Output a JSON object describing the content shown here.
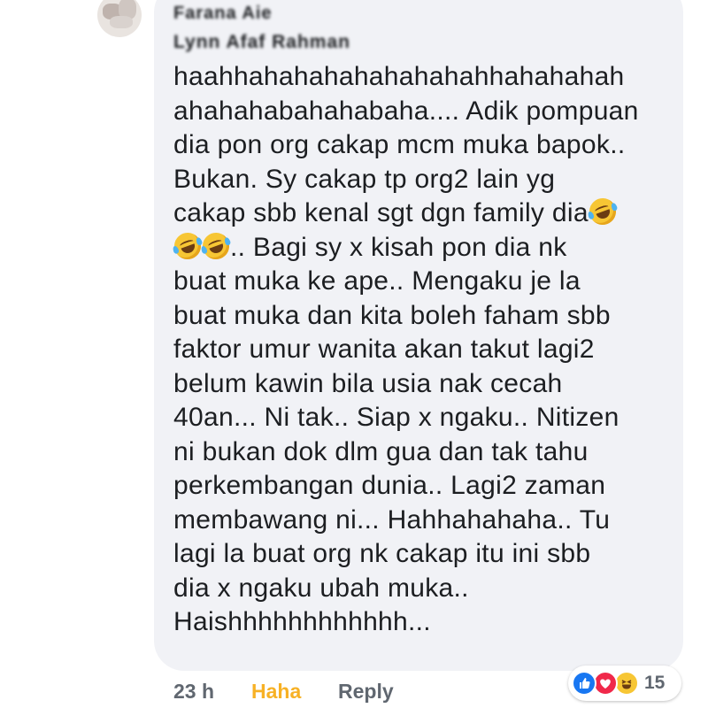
{
  "comment": {
    "commenter_name": "Farana Aie",
    "mention": "Lynn Afaf Rahman",
    "lines": [
      {
        "before": "haahhahahahahahahahahhahahahah",
        "emojis_after": 0
      },
      {
        "before": "ahahahabahahabaha.... Adik  pompuan",
        "emojis_after": 0
      },
      {
        "before": "dia pon org cakap mcm muka bapok..",
        "emojis_after": 0
      },
      {
        "before": "Bukan. Sy cakap tp org2 lain yg",
        "emojis_after": 0
      },
      {
        "before": "cakap sbb kenal sgt dgn family dia",
        "emojis_after": 1
      },
      {
        "emojis_before": 2,
        "before": ".. Bagi sy x kisah pon dia nk"
      },
      {
        "before": "buat muka ke ape.. Mengaku je la"
      },
      {
        "before": "buat muka dan kita boleh faham sbb"
      },
      {
        "before": "faktor umur wanita akan takut lagi2"
      },
      {
        "before": "belum kawin bila usia nak cecah"
      },
      {
        "before": "40an... Ni tak.. Siap x ngaku.. Nitizen"
      },
      {
        "before": "ni bukan dok dlm gua dan tak tahu"
      },
      {
        "before": "perkembangan dunia.. Lagi2 zaman"
      },
      {
        "before": "membawang ni... Hahhahahaha.. Tu"
      },
      {
        "before": "lagi la buat org nk cakap itu ini sbb"
      },
      {
        "before": "dia x ngaku ubah muka.."
      },
      {
        "before": "Haishhhhhhhhhhhh..."
      }
    ],
    "emoji_icon": "rolling-on-floor-laughing-emoji"
  },
  "footer": {
    "time": "23 h",
    "reaction_label": "Haha",
    "reply_label": "Reply"
  },
  "reactions": {
    "icons": [
      "like-icon",
      "love-icon",
      "haha-icon"
    ],
    "count": "15"
  },
  "colors": {
    "bubble": "#f1f2f6",
    "text": "#1c1e21",
    "meta": "#606770",
    "haha_active": "#f7b125",
    "like": "#1877f2",
    "love": "#f0284a"
  }
}
